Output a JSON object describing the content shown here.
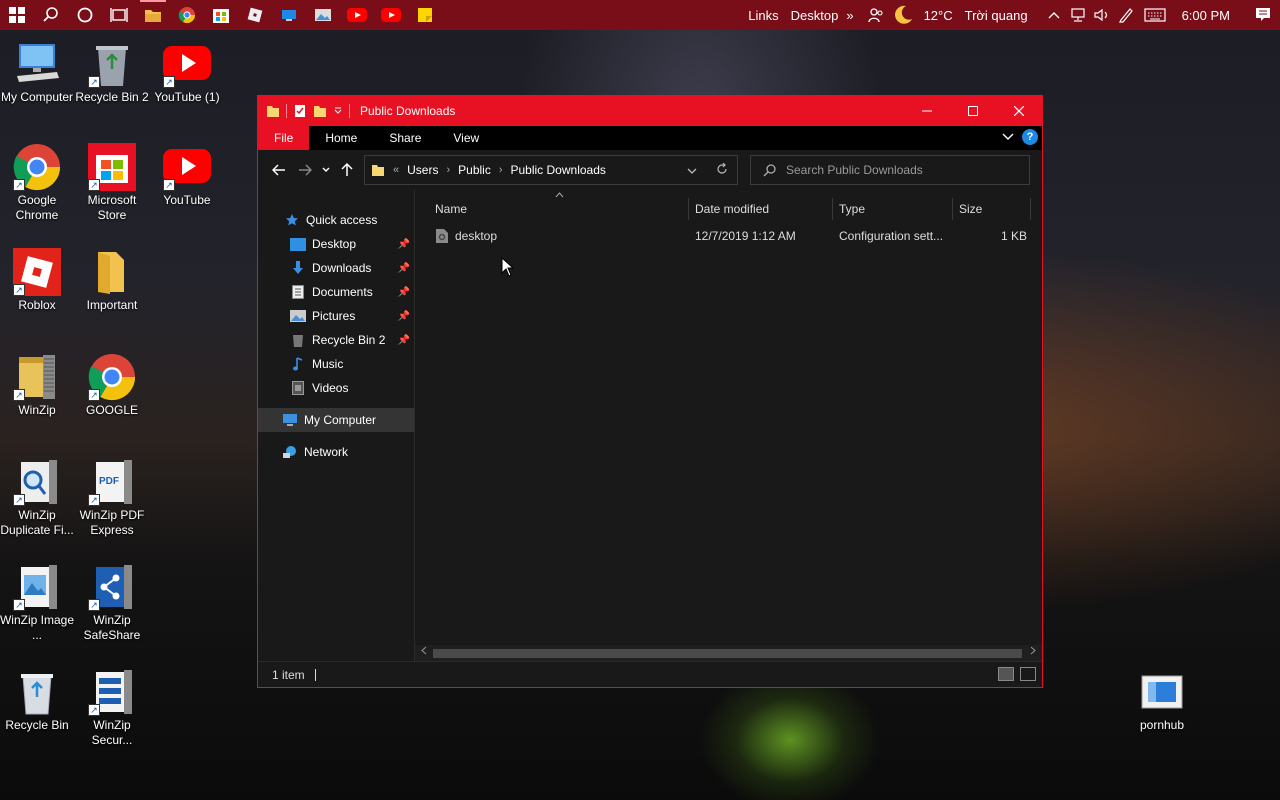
{
  "taskbar": {
    "links_label": "Links",
    "desktop_label": "Desktop",
    "overflow": "»",
    "temperature": "12°C",
    "weather": "Trời quang",
    "time": "6:00 PM"
  },
  "desktop_icons": [
    {
      "label": "My Computer",
      "icon": "computer-icon"
    },
    {
      "label": "Recycle Bin 2",
      "icon": "recycle-bin-icon"
    },
    {
      "label": "YouTube (1)",
      "icon": "youtube-icon"
    },
    {
      "label": "Google Chrome",
      "icon": "chrome-icon"
    },
    {
      "label": "Microsoft Store",
      "icon": "store-icon"
    },
    {
      "label": "YouTube",
      "icon": "youtube-icon"
    },
    {
      "label": "Roblox",
      "icon": "roblox-icon"
    },
    {
      "label": "Important",
      "icon": "folder-icon"
    },
    {
      "label": "WinZip",
      "icon": "winzip-icon"
    },
    {
      "label": "GOOGLE",
      "icon": "chrome-icon"
    },
    {
      "label": "WinZip Duplicate Fi...",
      "icon": "winzip-duplicate-icon"
    },
    {
      "label": "WinZip PDF Express",
      "icon": "winzip-pdf-icon"
    },
    {
      "label": "WinZip Image ...",
      "icon": "winzip-image-icon"
    },
    {
      "label": "WinZip SafeShare",
      "icon": "winzip-safeshare-icon"
    },
    {
      "label": "Recycle Bin",
      "icon": "recycle-bin-icon"
    },
    {
      "label": "WinZip Secur...",
      "icon": "winzip-secure-icon"
    },
    {
      "label": "pornhub",
      "icon": "web-shortcut-icon"
    }
  ],
  "explorer": {
    "title": "Public Downloads",
    "ribbon_tabs": [
      "File",
      "Home",
      "Share",
      "View"
    ],
    "breadcrumb": [
      "Users",
      "Public",
      "Public Downloads"
    ],
    "breadcrumb_prefix": "«",
    "search_placeholder": "Search Public Downloads",
    "nav": {
      "quick_access": "Quick access",
      "items": [
        "Desktop",
        "Downloads",
        "Documents",
        "Pictures",
        "Recycle Bin 2",
        "Music",
        "Videos"
      ],
      "my_computer": "My Computer",
      "network": "Network"
    },
    "columns": [
      "Name",
      "Date modified",
      "Type",
      "Size"
    ],
    "files": [
      {
        "name": "desktop",
        "modified": "12/7/2019 1:12 AM",
        "type": "Configuration sett...",
        "size": "1 KB"
      }
    ],
    "status": "1 item"
  },
  "colors": {
    "accent": "#e81123",
    "taskbar": "#7a0e18",
    "window_bg": "#191919"
  }
}
